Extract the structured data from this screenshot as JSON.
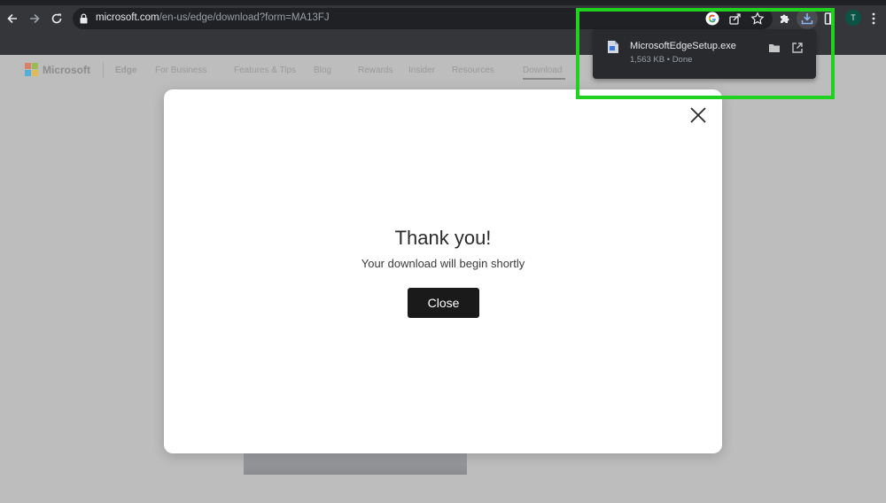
{
  "browser": {
    "url_host": "microsoft.com",
    "url_path": "/en-us/edge/download?form=MA13FJ",
    "profile_initial": "T",
    "icons": {
      "back": "back-arrow-icon",
      "forward": "forward-arrow-icon",
      "reload": "reload-icon",
      "lock": "lock-icon",
      "google": "google-icon",
      "share": "share-icon",
      "bookmark": "star-icon",
      "extensions": "puzzle-icon",
      "downloads": "download-icon",
      "side_panel": "side-panel-icon",
      "menu": "kebab-menu-icon"
    }
  },
  "page": {
    "brand": "Microsoft",
    "nav": [
      "Edge",
      "For Business",
      "Features & Tips",
      "Blog",
      "Rewards",
      "Insider",
      "Resources",
      "Download"
    ]
  },
  "modal": {
    "title": "Thank you!",
    "subtitle": "Your download will begin shortly",
    "close_button": "Close",
    "close_icon": "close-icon"
  },
  "downloads": {
    "filename": "MicrosoftEdgeSetup.exe",
    "status": "1,563 KB • Done",
    "icons": {
      "file": "installer-file-icon",
      "folder": "folder-icon",
      "open": "open-external-icon"
    }
  },
  "colors": {
    "highlight": "#1fd21f",
    "chrome_dark": "#35363a",
    "modal_button": "#1a1a1a"
  }
}
